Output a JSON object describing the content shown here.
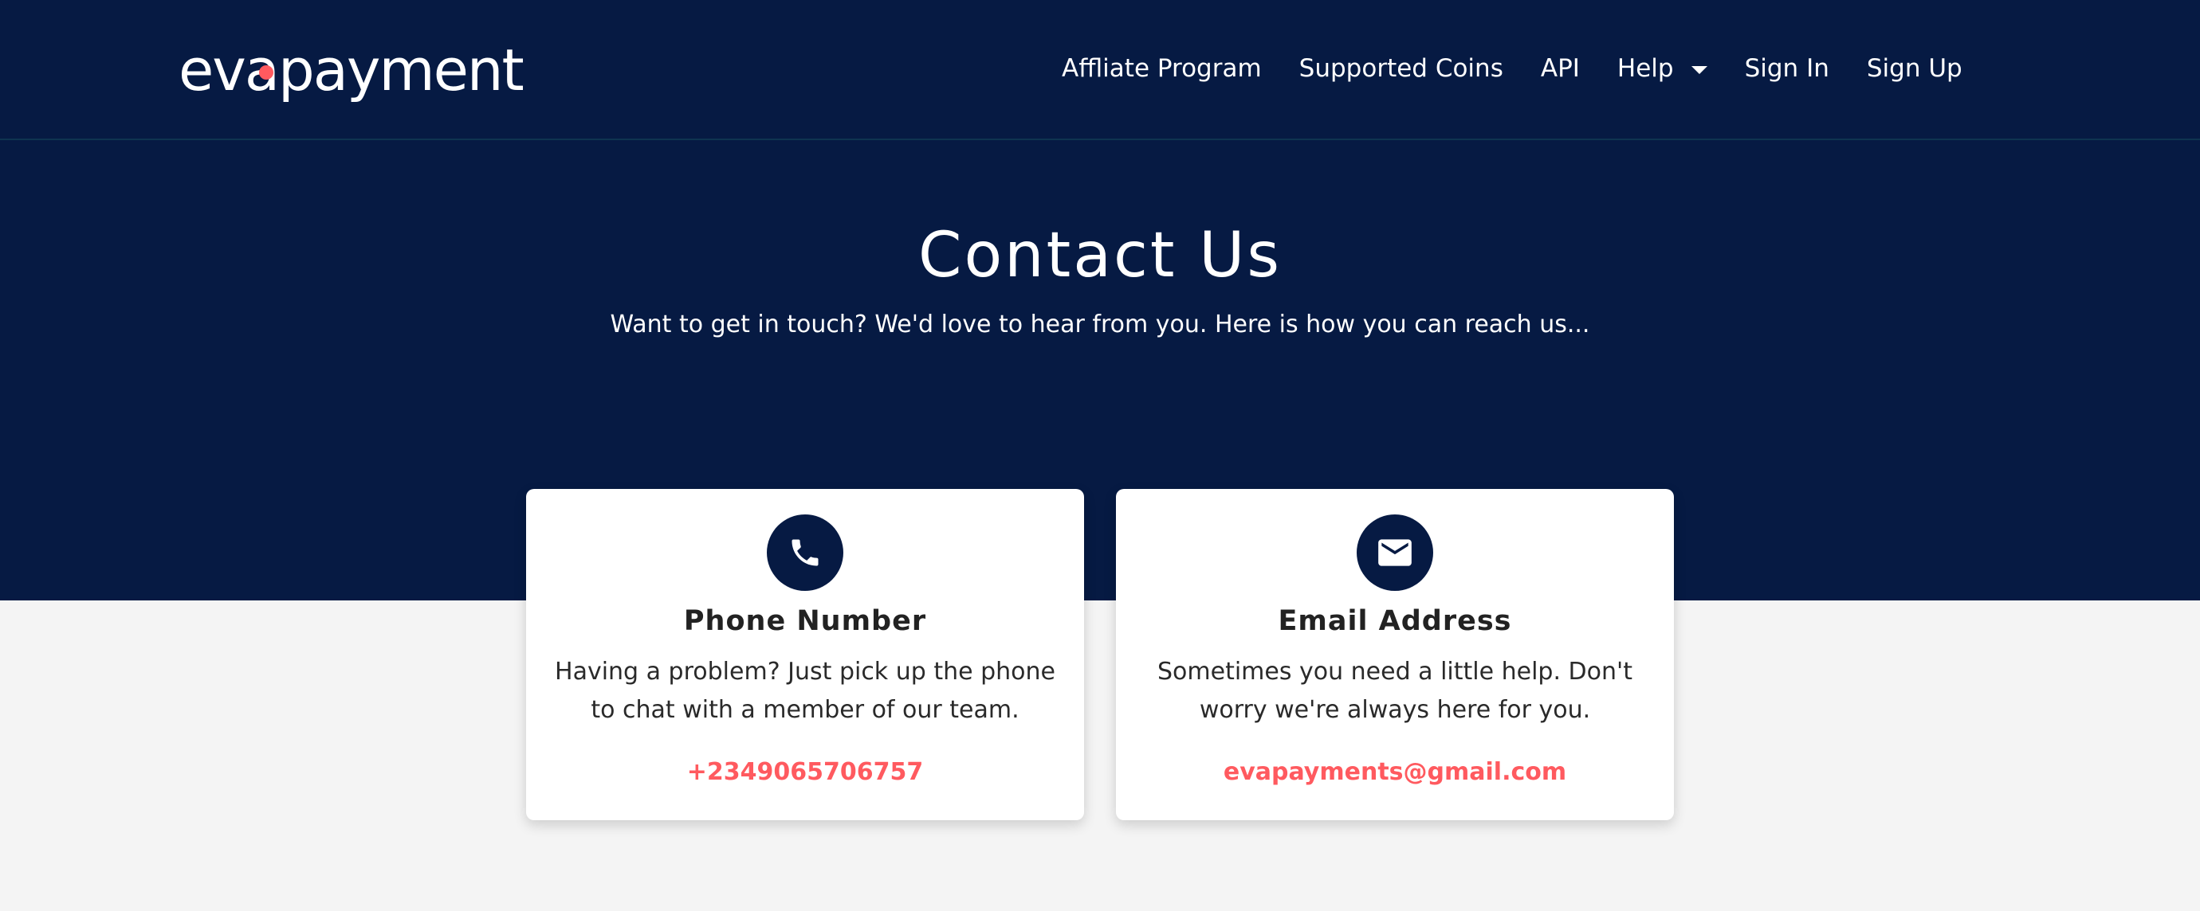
{
  "brand": {
    "logo_text": "evapayment",
    "accent_color": "#ff5a5f",
    "navy_color": "#061a43"
  },
  "nav": {
    "items": [
      {
        "label": "Affliate Program"
      },
      {
        "label": "Supported Coins"
      },
      {
        "label": "API"
      },
      {
        "label": "Help",
        "icon": "caret-down-icon"
      },
      {
        "label": "Sign In"
      },
      {
        "label": "Sign Up"
      }
    ]
  },
  "hero": {
    "title": "Contact Us",
    "subtitle": "Want to get in touch? We'd love to hear from you. Here is how you can reach us..."
  },
  "cards": {
    "phone": {
      "icon": "phone-icon",
      "title": "Phone Number",
      "description": "Having a problem? Just pick up the phone to chat with a member of our team.",
      "contact": "+2349065706757"
    },
    "email": {
      "icon": "envelope-icon",
      "title": "Email Address",
      "description": "Sometimes you need a little help. Don't worry we're always here for you.",
      "contact": "evapayments@gmail.com"
    }
  }
}
